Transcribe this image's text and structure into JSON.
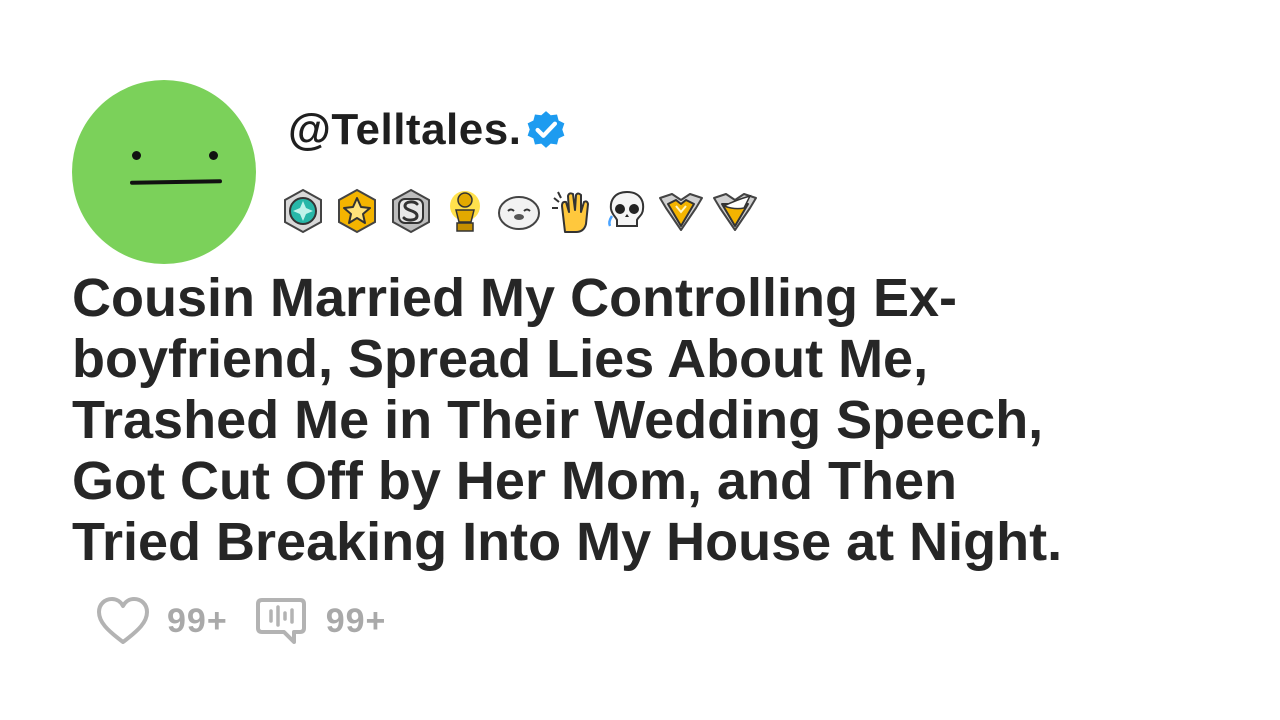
{
  "post": {
    "username": "@Telltales.",
    "title_lines": [
      "Cousin Married My Controlling Ex-",
      "boyfriend, Spread Lies About Me,",
      "Trashed Me in Their Wedding Speech,",
      "Got Cut Off by Her Mom, and Then",
      "Tried Breaking Into My House at Night."
    ],
    "likes": "99+",
    "comments": "99+"
  },
  "badges": [
    "teal-gem-award-icon",
    "gold-star-award-icon",
    "silver-s-award-icon",
    "gold-trophy-award-icon",
    "seal-emoji-icon",
    "clapping-hands-emoji-icon",
    "skull-emoji-icon",
    "gold-heart-shield-award-icon",
    "gold-wing-shield-award-icon"
  ],
  "colors": {
    "avatar": "#7bd15a",
    "verified": "#1d9bf0",
    "text": "#262626",
    "muted": "#a9a9a9"
  }
}
